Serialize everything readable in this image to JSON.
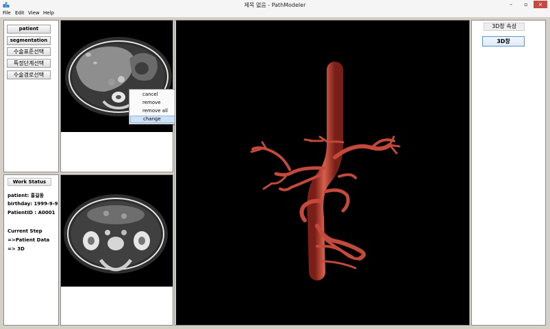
{
  "window": {
    "title": "제목 없음 - PathModeler",
    "minimize_label": "–",
    "maximize_label": "▫",
    "close_label": "×"
  },
  "menu": {
    "items": [
      {
        "label": "File"
      },
      {
        "label": "Edit"
      },
      {
        "label": "View"
      },
      {
        "label": "Help"
      }
    ]
  },
  "tools": {
    "patient_label": "patient",
    "segmentation_label": "segmentation",
    "standard_select_label": "수술표준선택",
    "stage_select_label": "특정단계선택",
    "path_select_label": "수술경로선택"
  },
  "work_status": {
    "title": "Work Status",
    "patient_line": "patient:  홍길동",
    "birthday_line": "birthday: 1999-9-9",
    "patient_id_line": "PatientID : A0001",
    "current_step_label": "Current Step",
    "step_1": "=>Patient Data",
    "step_2": "=> 3D"
  },
  "context_menu": {
    "items": [
      {
        "label": "cancel"
      },
      {
        "label": "remove"
      },
      {
        "label": "remove all"
      },
      {
        "label": "change"
      }
    ],
    "highlighted": "change"
  },
  "properties": {
    "title": "3D창 속성",
    "button_label": "3D창"
  },
  "colors": {
    "window_bg": "#d4d0c8",
    "close_button": "#c74a40",
    "vessel": "#c2493b",
    "menu_highlight": "#cfe2f5",
    "button_border": "#5b8fc7"
  }
}
